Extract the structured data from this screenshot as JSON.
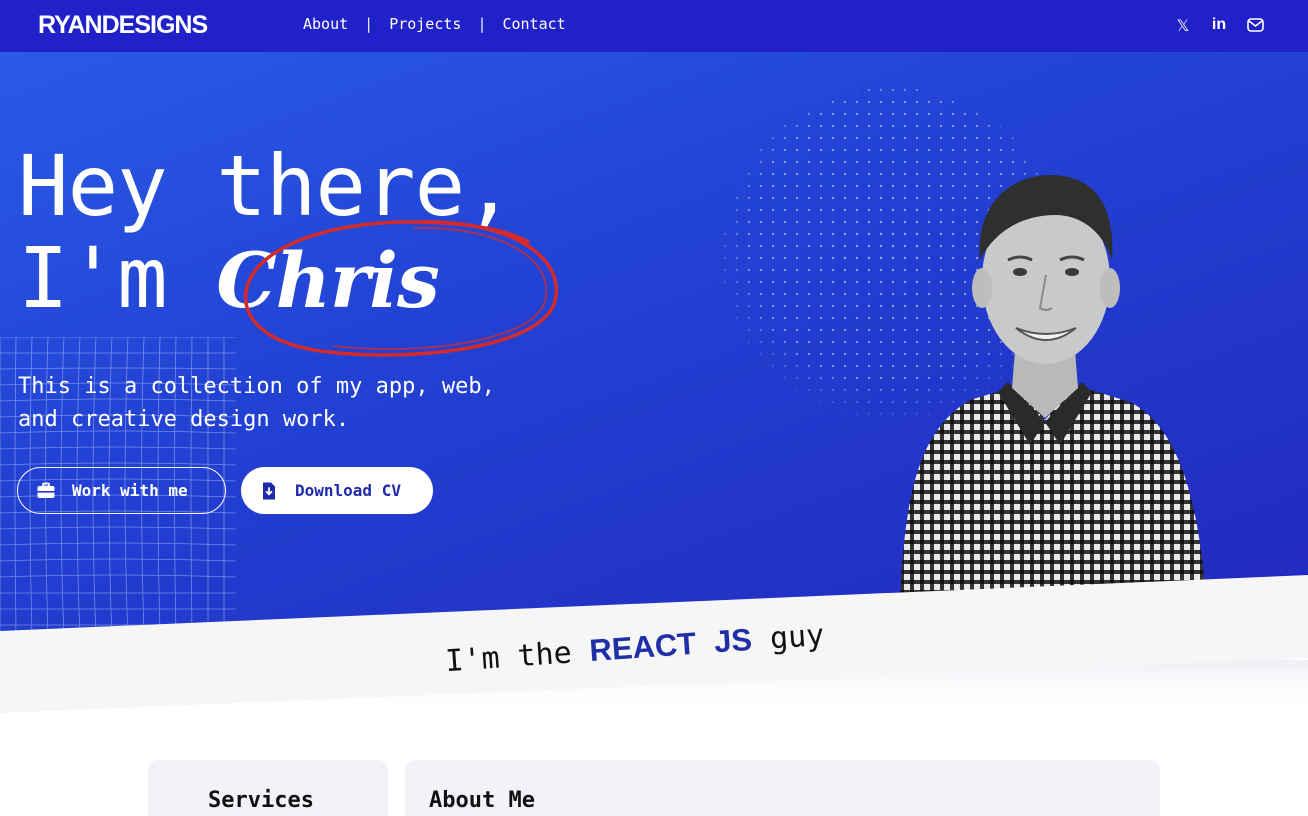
{
  "nav": {
    "logo": "RYANDESIGNS",
    "links": [
      "About",
      "Projects",
      "Contact"
    ],
    "separator": "|",
    "social": [
      {
        "name": "x-icon",
        "glyph": "𝕏"
      },
      {
        "name": "linkedin-icon",
        "glyph": "in"
      },
      {
        "name": "mail-icon",
        "glyph": "✉"
      }
    ]
  },
  "hero": {
    "greeting_line1": "Hey there,",
    "greeting_line2_prefix": "I'm ",
    "name": "Chris",
    "intro_line1": "This is a collection of my app, web,",
    "intro_line2": "and creative design work.",
    "buttons": {
      "work": "Work with me",
      "cv": "Download CV"
    }
  },
  "tagline": {
    "prefix": "I'm the",
    "highlight1": "REACT",
    "highlight2": "JS",
    "suffix": "guy"
  },
  "sections": {
    "services_title": "Services",
    "about_title": "About Me"
  },
  "colors": {
    "nav_bg": "#2121c9",
    "accent": "#1f2fa8",
    "circle_red": "#d52a2a"
  }
}
